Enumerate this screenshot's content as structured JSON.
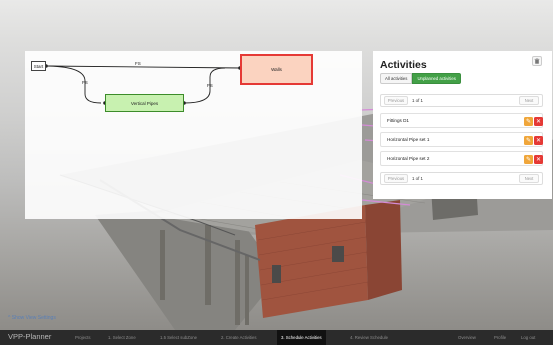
{
  "viewport": {
    "show_settings": "^ Show View Settings"
  },
  "diagram": {
    "nodes": {
      "start": "Start",
      "walls": "Walls",
      "vertical_pipes": "Vertical Pipes"
    },
    "edge_labels": {
      "top": "FS",
      "left": "FS",
      "right": "FS"
    }
  },
  "activities": {
    "title": "Activities",
    "tabs": {
      "all": "All activities",
      "unplanned": "Unplanned activities"
    },
    "pager": {
      "prev": "Previous",
      "info": "1 of 1",
      "next": "Next"
    },
    "items": [
      {
        "name": "Fittings D1"
      },
      {
        "name": "Horizontal Pipe set 1"
      },
      {
        "name": "Horizontal Pipe set 2"
      }
    ]
  },
  "nav": {
    "brand": "VPP-Planner",
    "items": [
      "Projects",
      "1. Select Zone",
      "1.5 Select subZone",
      "2. Create Activities",
      "3. Schedule Activities",
      "4. Review Schedule"
    ],
    "right": [
      "Overview",
      "Profile",
      "Log out"
    ]
  },
  "colors": {
    "walls_fill": "#fbd3c0",
    "walls_border": "#e53935",
    "pipes_fill": "#c8f1b0",
    "tab_active": "#43a047",
    "edit": "#f0a63a",
    "delete": "#e53935"
  }
}
